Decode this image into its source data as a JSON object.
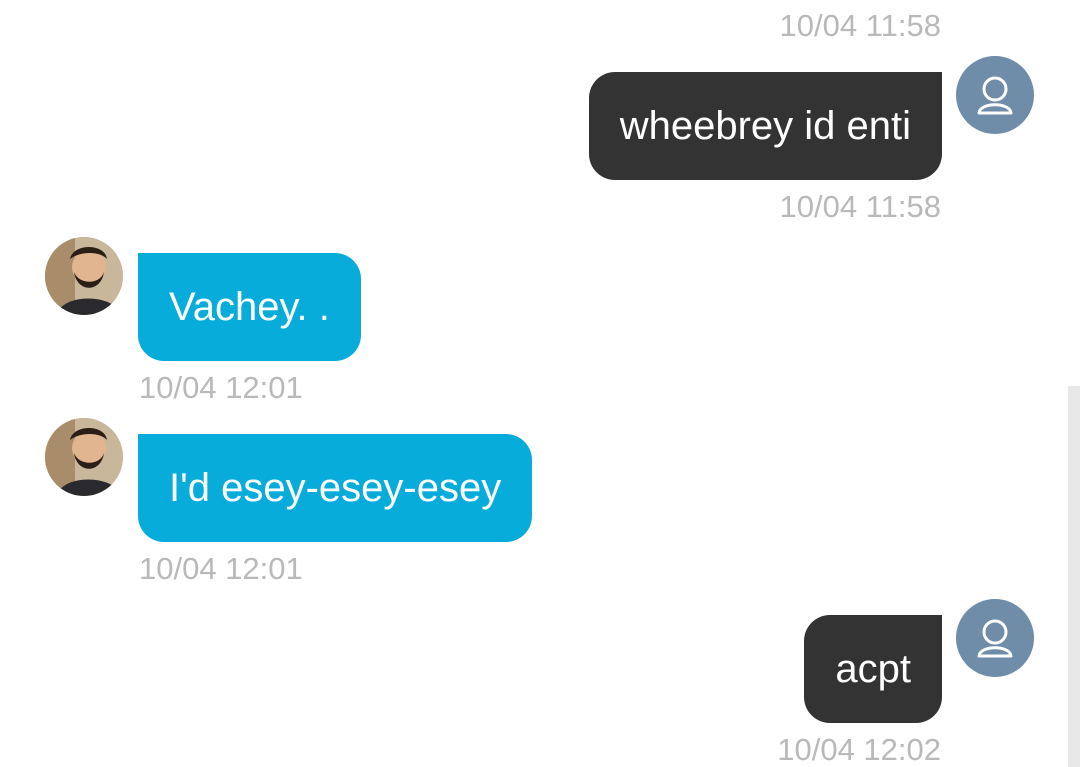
{
  "messages": [
    {
      "direction": "out",
      "text": "wheebrey id enti",
      "time_above": "10/04 11:58",
      "time_below": "10/04 11:58"
    },
    {
      "direction": "in",
      "text": "Vachey. .",
      "time_below": "10/04 12:01"
    },
    {
      "direction": "in",
      "text": "I'd esey-esey-esey",
      "time_below": "10/04 12:01"
    },
    {
      "direction": "out",
      "text": "acpt",
      "time_below": "10/04 12:02"
    }
  ],
  "colors": {
    "outgoing_bubble": "#333333",
    "incoming_bubble": "#08acdb",
    "timestamp": "#b9b9b9",
    "my_avatar_bg": "#6f8ca9"
  },
  "icons": {
    "my_avatar": "user-icon",
    "contact_avatar": "contact-photo"
  }
}
